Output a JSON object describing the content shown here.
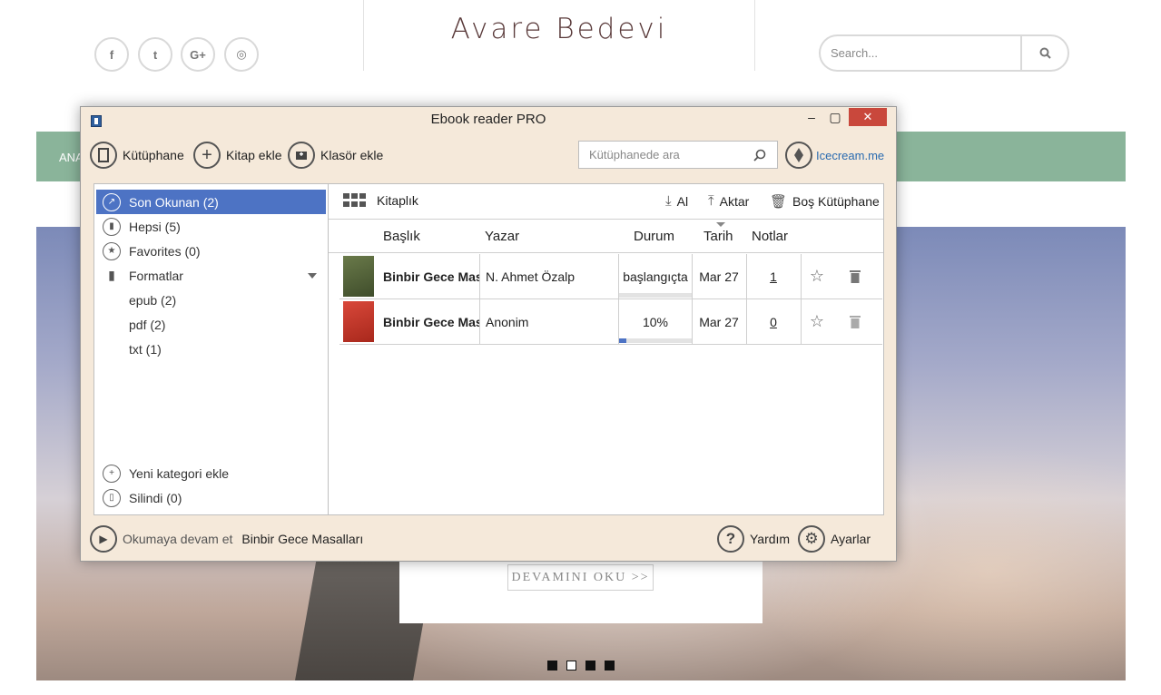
{
  "site": {
    "title": "Avare Bedevi",
    "social": [
      {
        "name": "facebook-icon",
        "glyph": "f"
      },
      {
        "name": "twitter-icon",
        "glyph": "t"
      },
      {
        "name": "google-plus-icon",
        "glyph": "G+"
      },
      {
        "name": "instagram-icon",
        "glyph": "◎"
      }
    ],
    "search_placeholder": "Search...",
    "nav_first": "ANA",
    "read_more": "DEVAMINI OKU >>"
  },
  "app": {
    "title": "Ebook reader PRO",
    "toolbar": {
      "library": "Kütüphane",
      "add_book": "Kitap ekle",
      "add_folder": "Klasör ekle",
      "search_placeholder": "Kütüphanede ara",
      "brand_link": "Icecream.me"
    },
    "sidebar": {
      "items": [
        {
          "label": "Son Okunan (2)"
        },
        {
          "label": "Hepsi (5)"
        },
        {
          "label": "Favorites (0)"
        },
        {
          "label": "Formatlar"
        },
        {
          "label": "epub (2)"
        },
        {
          "label": "pdf (2)"
        },
        {
          "label": "txt (1)"
        }
      ],
      "new_category": "Yeni kategori ekle",
      "deleted": "Silindi (0)"
    },
    "library_bar": {
      "view_label": "Kitaplık",
      "import": "Al",
      "export": "Aktar",
      "empty": "Boş Kütüphane"
    },
    "columns": {
      "title": "Başlık",
      "author": "Yazar",
      "status": "Durum",
      "date": "Tarih",
      "notes": "Notlar"
    },
    "books": [
      {
        "title": "Binbir Gece Masalları",
        "author": "N. Ahmet Özalp",
        "status": "başlangıçta",
        "progress": 0,
        "date": "Mar 27",
        "notes": "1"
      },
      {
        "title": "Binbir Gece Masalları",
        "author": "Anonim",
        "status": "10%",
        "progress": 0.1,
        "date": "Mar 27",
        "notes": "0"
      }
    ],
    "bottom": {
      "continue_label": "Okumaya devam et",
      "continue_book": "Binbir Gece Masalları",
      "help": "Yardım",
      "settings": "Ayarlar"
    }
  }
}
